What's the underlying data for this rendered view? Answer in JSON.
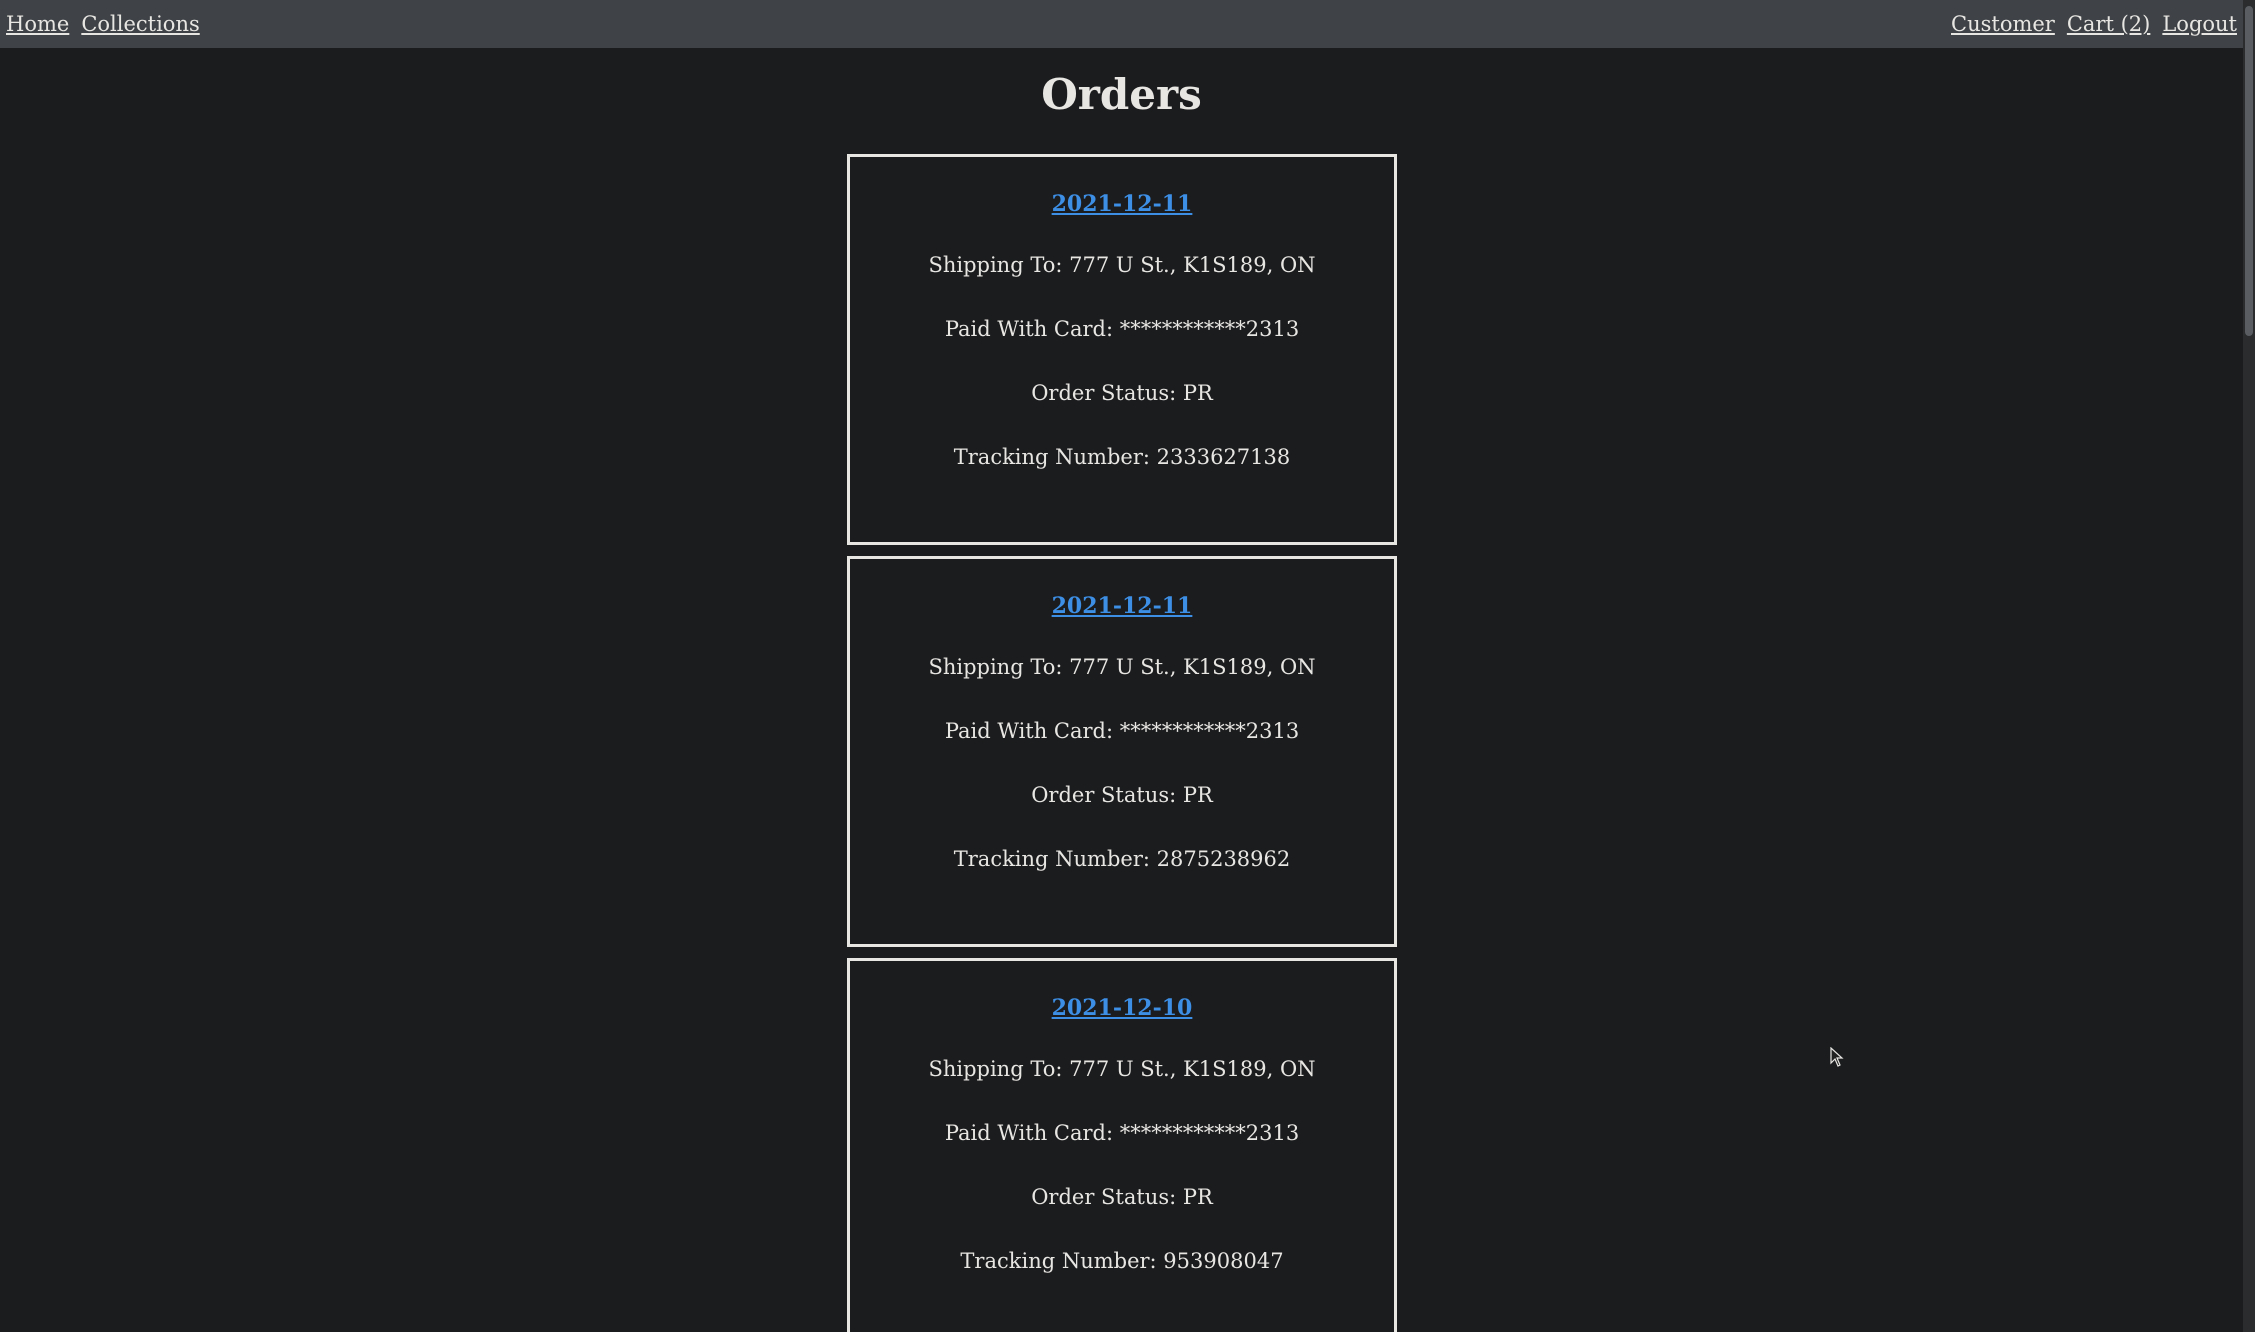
{
  "nav": {
    "left": [
      {
        "label": "Home"
      },
      {
        "label": "Collections"
      }
    ],
    "right": [
      {
        "label": "Customer"
      },
      {
        "label": "Cart (2)"
      },
      {
        "label": "Logout"
      }
    ]
  },
  "page": {
    "title": "Orders"
  },
  "orders": [
    {
      "date": "2021-12-11",
      "shipping": "Shipping To: 777 U St., K1S189, ON",
      "card": "Paid With Card: ************2313",
      "status": "Order Status: PR",
      "tracking": "Tracking Number: 2333627138"
    },
    {
      "date": "2021-12-11",
      "shipping": "Shipping To: 777 U St., K1S189, ON",
      "card": "Paid With Card: ************2313",
      "status": "Order Status: PR",
      "tracking": "Tracking Number: 2875238962"
    },
    {
      "date": "2021-12-10",
      "shipping": "Shipping To: 777 U St., K1S189, ON",
      "card": "Paid With Card: ************2313",
      "status": "Order Status: PR",
      "tracking": "Tracking Number: 953908047"
    }
  ],
  "colors": {
    "background": "#1b1c1e",
    "navbar": "#3f4347",
    "link": "#3d8fe6",
    "text": "#e8e6e3"
  }
}
